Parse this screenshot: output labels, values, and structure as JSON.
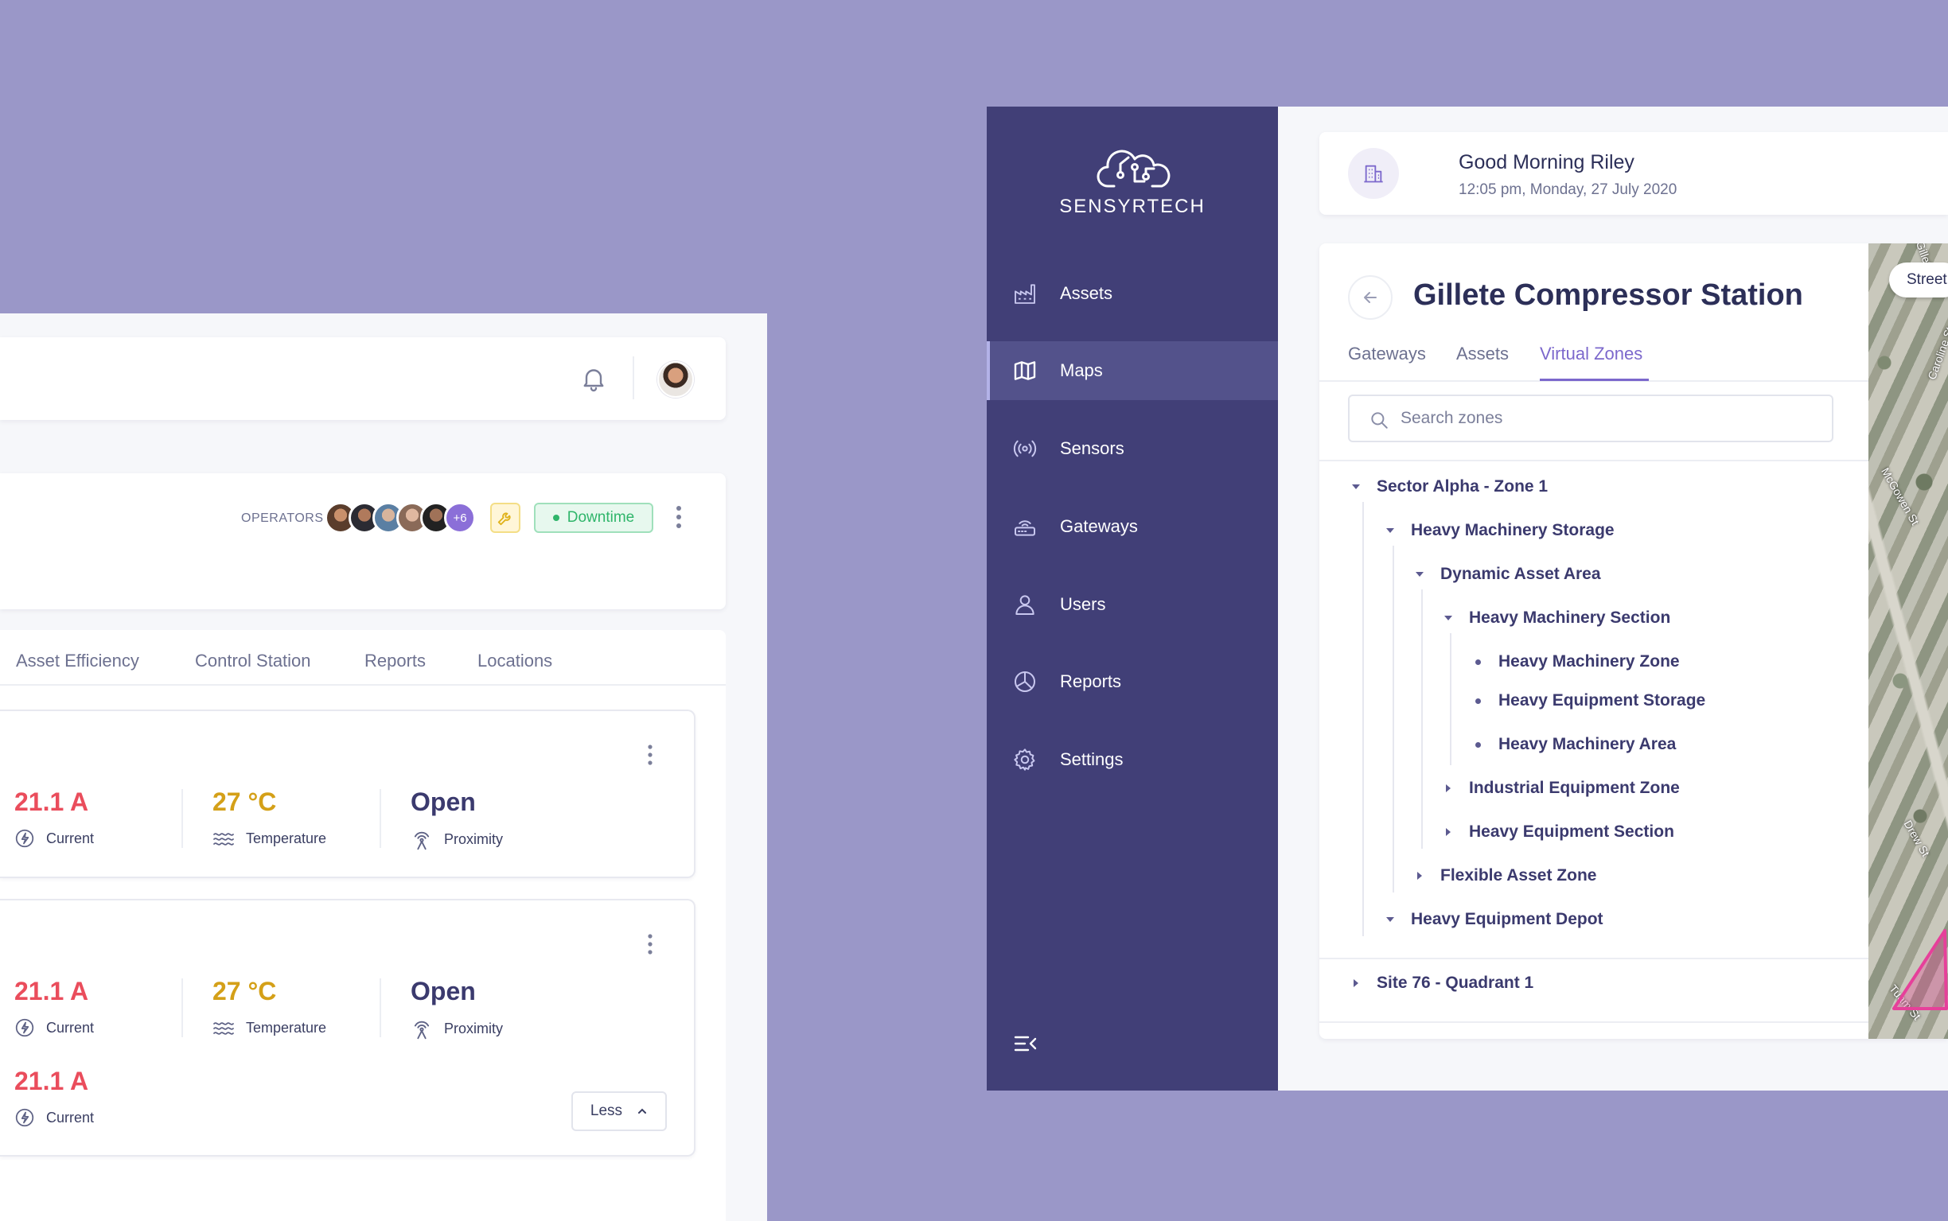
{
  "left": {
    "operators_label": "OPERATORS",
    "operators_more": "+6",
    "status_badge": "Downtime",
    "tabs": [
      "Asset Efficiency",
      "Control Station",
      "Reports",
      "Locations"
    ],
    "cards": [
      {
        "metrics": [
          {
            "value": "21.1 A",
            "label": "Current"
          },
          {
            "value": "27 °C",
            "label": "Temperature"
          },
          {
            "value": "Open",
            "label": "Proximity"
          }
        ]
      },
      {
        "metrics": [
          {
            "value": "21.1 A",
            "label": "Current"
          },
          {
            "value": "27 °C",
            "label": "Temperature"
          },
          {
            "value": "Open",
            "label": "Proximity"
          },
          {
            "value": "21.1 A",
            "label": "Current"
          }
        ],
        "less_button": "Less"
      }
    ]
  },
  "sidebar": {
    "brand": "SENSYRTECH",
    "items": [
      {
        "label": "Assets",
        "icon": "factory-icon"
      },
      {
        "label": "Maps",
        "icon": "map-icon",
        "active": true
      },
      {
        "label": "Sensors",
        "icon": "sensor-icon"
      },
      {
        "label": "Gateways",
        "icon": "gateway-icon"
      },
      {
        "label": "Users",
        "icon": "user-icon"
      },
      {
        "label": "Reports",
        "icon": "pie-chart-icon"
      },
      {
        "label": "Settings",
        "icon": "gear-icon"
      }
    ]
  },
  "greeting": {
    "title": "Good Morning Riley",
    "subtitle": "12:05 pm, Monday, 27 July 2020"
  },
  "station": {
    "title": "Gillete Compressor Station",
    "tabs": [
      "Gateways",
      "Assets",
      "Virtual Zones"
    ],
    "active_tab": "Virtual Zones",
    "search_placeholder": "Search zones",
    "tree": [
      "Sector Alpha - Zone 1",
      "Heavy Machinery Storage",
      "Dynamic Asset Area",
      "Heavy Machinery Section",
      "Heavy Machinery Zone",
      "Heavy Equipment Storage",
      "Heavy Machinery Area",
      "Industrial Equipment Zone",
      "Heavy Equipment Section",
      "Flexible Asset Zone",
      "Heavy Equipment Depot",
      "Site 76 - Quadrant 1"
    ]
  },
  "map": {
    "street_button": "Street",
    "labels": [
      "Caroline St",
      "McGowen St",
      "Drew St",
      "Tuam St",
      "Gillette"
    ]
  },
  "colors": {
    "background": "#9a97c8",
    "sidebar": "#413f77",
    "accent": "#7c68cc",
    "danger": "#ea4d5c",
    "warning": "#d4a018",
    "success": "#2fb56a"
  }
}
